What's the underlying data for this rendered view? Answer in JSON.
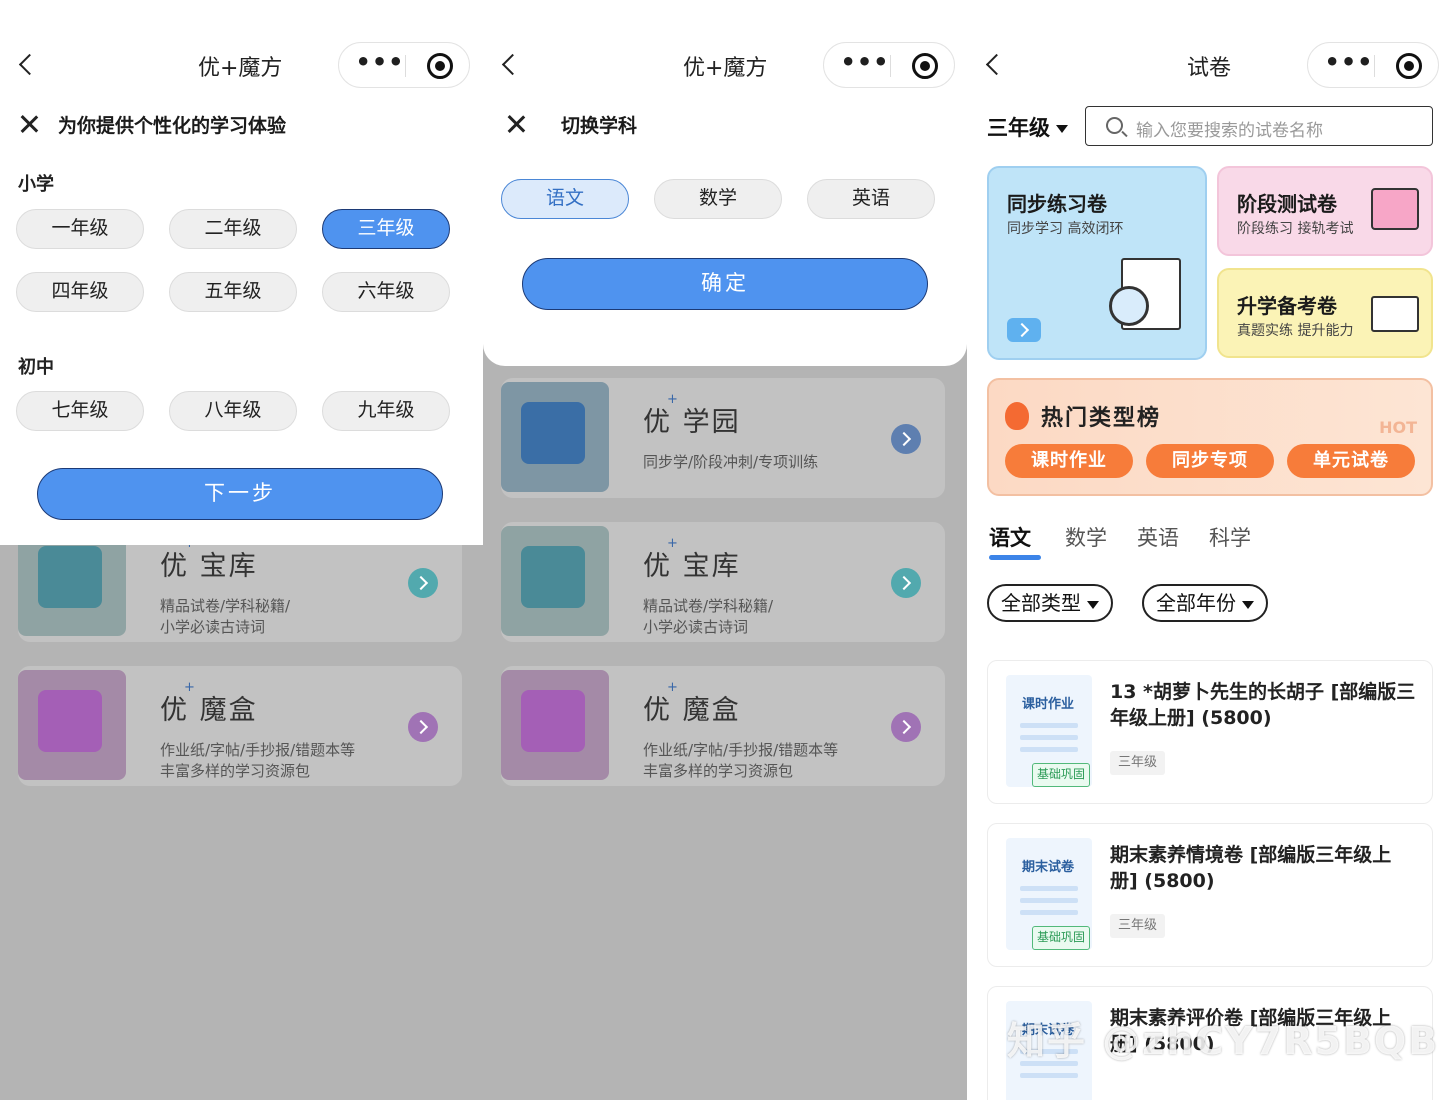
{
  "panel1": {
    "nav_title": "优+魔方",
    "capsule_dots": "•••",
    "sheet_title": "为你提供个性化的学习体验",
    "primary_label": "小学",
    "primary_grades": [
      "一年级",
      "二年级",
      "三年级",
      "四年级",
      "五年级",
      "六年级"
    ],
    "middle_label": "初中",
    "middle_grades": [
      "七年级",
      "八年级",
      "九年级"
    ],
    "selected_grade": "三年级",
    "next_button": "下一步"
  },
  "panel2": {
    "nav_title": "优+魔方",
    "capsule_dots": "•••",
    "sheet_title": "切换学科",
    "subjects": [
      "语文",
      "数学",
      "英语"
    ],
    "selected_subject": "语文",
    "confirm_button": "确定"
  },
  "cards": [
    {
      "name": "优 学园",
      "sup": "+",
      "desc": "同步学/阶段冲刺/专项训练",
      "accent": "#5e7fb0"
    },
    {
      "name": "优 宝库",
      "sup": "+",
      "desc": "精品试卷/学科秘籍/小学必读古诗词",
      "accent": "#52a9ae"
    },
    {
      "name": "优 魔盒",
      "sup": "+",
      "desc": "作业纸/字帖/手抄报/错题本等丰富多样的学习资源包",
      "accent": "#a073b5"
    }
  ],
  "card_desc_lines": {
    "xueyuan": [
      "同步学/阶段冲刺/专项训练"
    ],
    "baoku": [
      "精品试卷/学科秘籍/",
      "小学必读古诗词"
    ],
    "mohe": [
      "作业纸/字帖/手抄报/错题本等",
      "丰富多样的学习资源包"
    ]
  },
  "panel3": {
    "nav_title": "试卷",
    "capsule_dots": "•••",
    "grade_selector": "三年级",
    "search_placeholder": "输入您要搜索的试卷名称",
    "tiles": {
      "sync": {
        "title": "同步练习卷",
        "sub": "同步学习 高效闭环"
      },
      "stage": {
        "title": "阶段测试卷",
        "sub": "阶段练习 接轨考试"
      },
      "upgrade": {
        "title": "升学备考卷",
        "sub": "真题实练 提升能力"
      }
    },
    "hot": {
      "title": "热门类型榜",
      "watermark": "HOT",
      "buttons": [
        "课时作业",
        "同步专项",
        "单元试卷"
      ]
    },
    "subject_tabs": [
      "语文",
      "数学",
      "英语",
      "科学"
    ],
    "active_subject_tab": "语文",
    "filters": [
      "全部类型",
      "全部年份"
    ],
    "papers": [
      {
        "cover_type": "课时作业",
        "cover_tag": "基础巩固",
        "title": "13 *胡萝卜先生的长胡子 [部编版三年级上册] (5800)",
        "grade": "三年级"
      },
      {
        "cover_type": "期末试卷",
        "cover_tag": "基础巩固",
        "title": "期末素养情境卷 [部编版三年级上册] (5800)",
        "grade": "三年级"
      },
      {
        "cover_type": "期末试卷",
        "cover_tag": "",
        "title": "期末素养评价卷 [部编版三年级上册] (5800)",
        "grade": ""
      }
    ],
    "watermark": "知乎 @zhCY7R5BQB"
  }
}
